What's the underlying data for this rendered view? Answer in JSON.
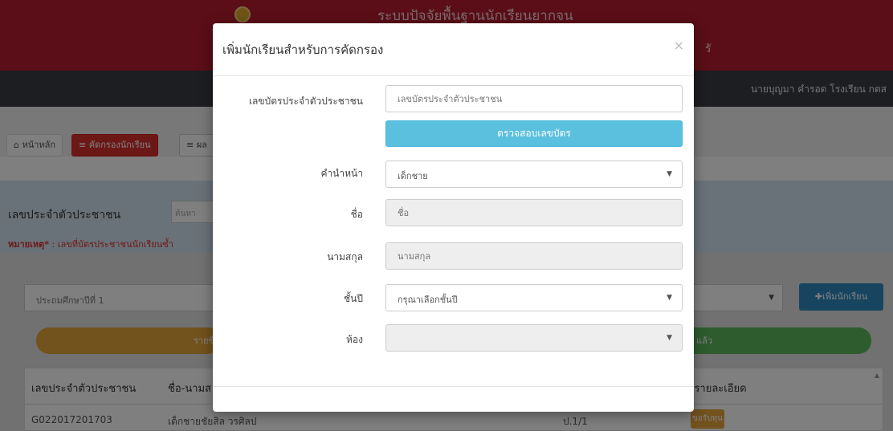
{
  "app": {
    "system_title": "ระบบปัจจัยพื้นฐานนักเรียนยากจน",
    "system_sub": "รั",
    "user_info": "นายบุญมา คำรอด โรงเรียน กตส"
  },
  "menu": {
    "home": "หน้าหลัก",
    "screen": "≡ คัดกรองนักเรียน",
    "third": "≡ ผล"
  },
  "search": {
    "id_label": "เลขประจำตัวประชาชน",
    "id_placeholder": "ค้นหา",
    "note_label": "หมายเหตุ*",
    "note_text": " : เลขที่บัตรประชาชนนักเรียนซ้ำ"
  },
  "main": {
    "year_select": "ประถมศึกษาปีที่ 1",
    "add_student_button": "✚เพิ่มนักเรียน",
    "pill_orange": "รายชื่",
    "pill_green": "แล้ว"
  },
  "table": {
    "headers": [
      "เลขประจำตัวประชาชน",
      "ชื่อ-นามส",
      "ดูรายละเอียด"
    ],
    "rows": [
      {
        "id": "G022017201703",
        "name": "เด็กชายชัยสิล วรศิลป",
        "class": "ป.1/1",
        "action": "ขอรับทุน"
      }
    ]
  },
  "modal": {
    "title": "เพิ่มนักเรียนสำหรับการคัดกรอง",
    "close": "×",
    "fields": {
      "id_card": {
        "label": "เลขบัตรประจำตัวประชาชน",
        "placeholder": "เลขบัตรประจำตัวประชาชน"
      },
      "verify_button": "ตรวจสอบเลขบัตร",
      "prefix": {
        "label": "คำนำหน้า",
        "value": "เด็กชาย"
      },
      "first_name": {
        "label": "ชื่อ",
        "placeholder": "ชื่อ"
      },
      "last_name": {
        "label": "นามสกุล",
        "placeholder": "นามสกุล"
      },
      "grade": {
        "label": "ชั้นปี",
        "value": "กรุณาเลือกชั้นปี"
      },
      "room": {
        "label": "ห้อง",
        "value": ""
      }
    }
  },
  "colors": {
    "header_red": "#b71c2e",
    "navbar_dark": "#3a3d42",
    "info_blue": "#5bc0de",
    "primary_blue": "#2e8bc0",
    "warning_orange": "#e4a43a",
    "success_green": "#5cb85c"
  }
}
